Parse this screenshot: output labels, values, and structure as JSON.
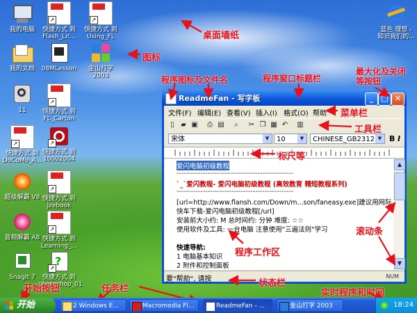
{
  "desktop_icons": [
    {
      "label": "我的电脑"
    },
    {
      "label": "快捷方式 到\nFlash_Lit..."
    },
    {
      "label": "快捷方式 到\nUsing_FL"
    },
    {
      "label": "我的文档"
    },
    {
      "label": "08MLesson"
    },
    {
      "label": "金山打字\n2003"
    },
    {
      "label": "11"
    },
    {
      "label": "快捷方式 到\nFL_Carton"
    },
    {
      "label": "快捷方式 到\nDoCoMo_A..."
    },
    {
      "label": "快捷方式 到\n10002004"
    },
    {
      "label": "超级解霸 V8"
    },
    {
      "label": "快捷方式 到\njzebook"
    },
    {
      "label": "音频解霸 A8"
    },
    {
      "label": "快捷方式 到\nLearning_..."
    },
    {
      "label": "SnagIt 7"
    },
    {
      "label": "快捷方式 到\nphotoshop_01"
    },
    {
      "label": "蓝色 理想 -\n知识我们的..."
    }
  ],
  "annotations": {
    "wallpaper": "桌面墙纸",
    "icon": "图标",
    "app_icon_filename": "程序图标及文件名",
    "titlebar": "程序窗口标题栏",
    "min_max_close": "最大化及关闭\n等按钮",
    "menubar": "菜单栏",
    "toolbar": "工具栏",
    "ruler": "标尺等",
    "workspace": "程序工作区",
    "scrollbar": "滚动条",
    "statusbar": "状态栏",
    "start_button": "开始按钮",
    "taskbar": "任务栏",
    "tray": "实时程序和时间"
  },
  "window": {
    "title": "ReadmeFan - 写字板",
    "menus": [
      "文件(F)",
      "编辑(E)",
      "查看(V)",
      "插入(I)",
      "格式(O)",
      "帮助"
    ],
    "font": "宋体",
    "size": "10",
    "charset": "CHINESE_GB2312",
    "bold": "B",
    "italic": "I",
    "doc_lines": [
      "爱闪电脑初级教程",
      "-------------------------------------------------",
      "`_`爱闪教程- 爱闪电脑初级教程    (高效教育 精短教程系列)",
      "-------------------------------------------------",
      "[url=http://www.flansh.com/Down/m...son/faneasy.exe]建议用网际",
      "快车下载-爱闪电脑初级教程[/url]",
      "安装前大小约: M  总时间约: 分钟  难度: ☆☆",
      "使用软件及工具: 一台电脑 注意使用\"三遍法则\"学习",
      "",
      "快速导航:",
      "1   电脑基本知识",
      "2   附件和控制面板"
    ],
    "status": "要\"帮助\", 请按",
    "status_num": "NUM"
  },
  "taskbar": {
    "start": "开始",
    "tasks": [
      "2 Windows E...",
      "Macromedia Fl...",
      "ReadmeFan - ...",
      "金山打字 2003"
    ],
    "clock": "18:24"
  }
}
